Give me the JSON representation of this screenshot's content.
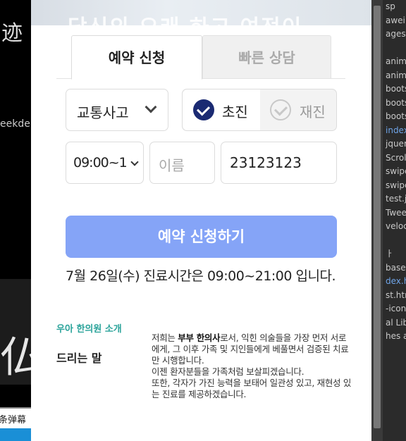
{
  "background_left": {
    "top_glyph": "迹",
    "side_text": "eekder",
    "bottom_glyph": "仏",
    "banner_text": "条弹幕"
  },
  "devtools": {
    "files": [
      {
        "label": "sp",
        "kind": "plain"
      },
      {
        "label": "awei",
        "kind": "plain"
      },
      {
        "label": "ages",
        "kind": "plain"
      },
      {
        "label": "",
        "kind": "plain"
      },
      {
        "label": "anim",
        "kind": "file"
      },
      {
        "label": "anim",
        "kind": "file"
      },
      {
        "label": "boots",
        "kind": "file"
      },
      {
        "label": "boots",
        "kind": "file"
      },
      {
        "label": "boots",
        "kind": "file"
      },
      {
        "label": "index",
        "kind": "blue"
      },
      {
        "label": "jquer",
        "kind": "file"
      },
      {
        "label": "Scrol",
        "kind": "file"
      },
      {
        "label": "swipe",
        "kind": "file"
      },
      {
        "label": "swipe",
        "kind": "file"
      },
      {
        "label": "test.js",
        "kind": "file"
      },
      {
        "label": "Twee",
        "kind": "file"
      },
      {
        "label": "veloc",
        "kind": "file"
      },
      {
        "label": "",
        "kind": "plain"
      },
      {
        "label": "ㅏ",
        "kind": "plain"
      },
      {
        "label": "base.h",
        "kind": "plain"
      },
      {
        "label": "dex.htm",
        "kind": "blue"
      },
      {
        "label": "st.htm",
        "kind": "plain"
      },
      {
        "label": "-icon.",
        "kind": "plain"
      },
      {
        "label": "al Lib",
        "kind": "plain"
      },
      {
        "label": "hes ar",
        "kind": "plain"
      }
    ]
  },
  "modal": {
    "hero_text": "당신의 오래 하고 여전이",
    "tabs": [
      {
        "label": "예약 신청",
        "active": true
      },
      {
        "label": "빠른 상담",
        "active": false
      }
    ],
    "treatment_type": "교통사고",
    "visit": {
      "first_label": "초진",
      "first_checked": true,
      "return_label": "재진",
      "return_checked": false
    },
    "time_value": "09:00~1",
    "name_placeholder": "이름",
    "phone_value": "23123123",
    "submit_label": "예약 신청하기",
    "notice": "7월 26일(수) 진료시간은 09:00~21:00 입니다.",
    "intro_link": "우아 한의원 소개",
    "greeting_title": "드리는 말",
    "greeting_body": {
      "prefix": "저희는 ",
      "bold": "부부 한의사",
      "rest": "로서, 익힌 의술들을 가장 먼저 서로에게, 그 이후 가족 및 지인들에게 베풀면서 검증된 치료만 시행합니다.",
      "line2": "이젠 환자분들을 가족처럼 보살피겠습니다.",
      "line3": "또한, 각자가 가진 능력을 보태어 일관성 있고, 재현성 있는 진료를 제공하겠습니다."
    }
  }
}
